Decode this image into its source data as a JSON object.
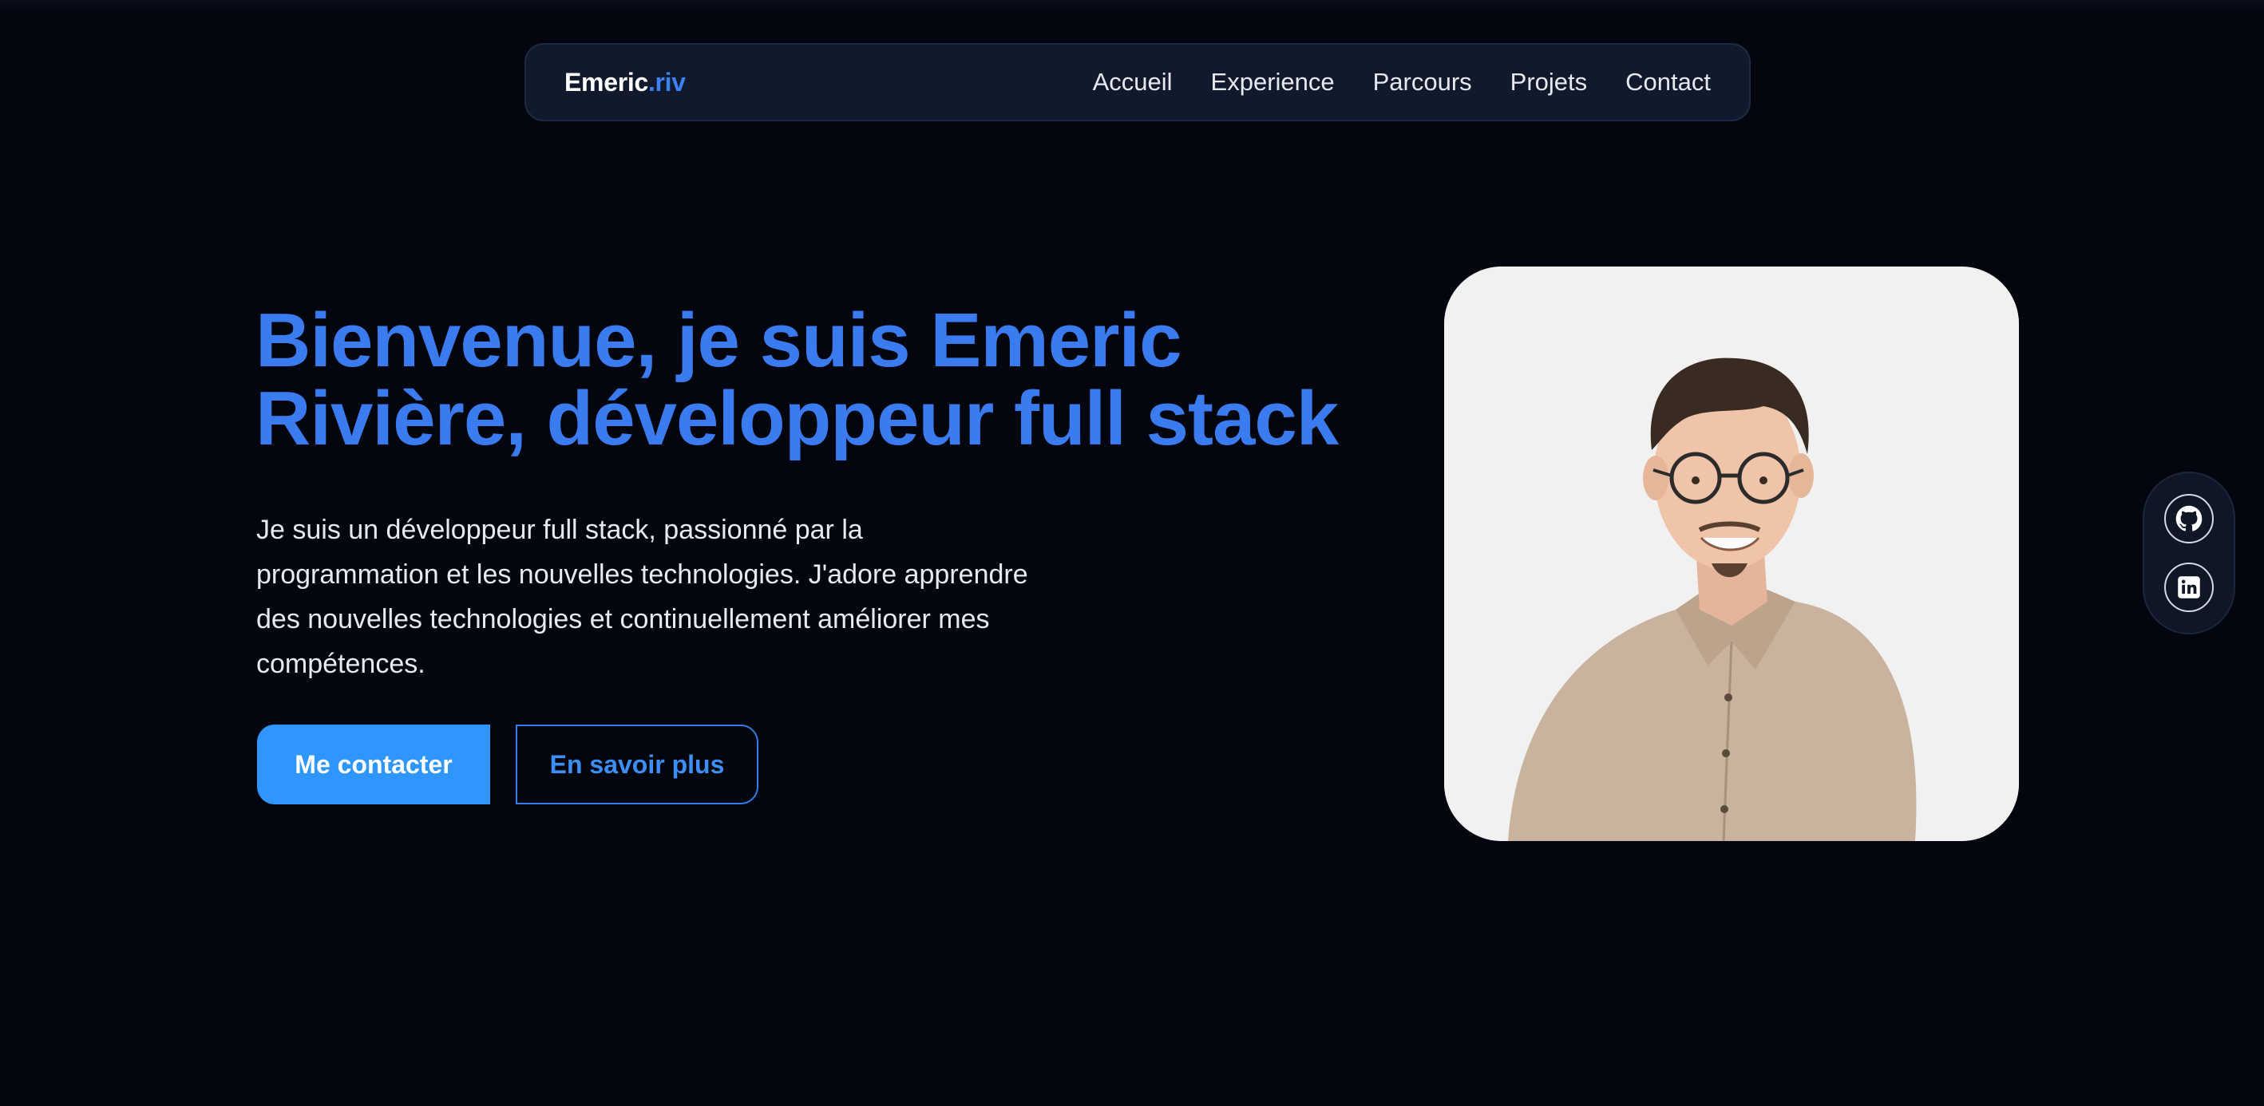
{
  "nav": {
    "logo_main": "Emeric",
    "logo_accent": ".riv",
    "links": [
      "Accueil",
      "Experience",
      "Parcours",
      "Projets",
      "Contact"
    ]
  },
  "hero": {
    "title_line1": "Bienvenue, je suis Emeric",
    "title_line2": "Rivière, développeur full stack",
    "description_lines": [
      "Je suis un développeur full stack, passionné par la",
      "programmation et les nouvelles technologies. J'adore apprendre",
      "des nouvelles technologies et continuellement améliorer mes",
      "compétences."
    ],
    "primary_button": "Me contacter",
    "secondary_button": "En savoir plus"
  },
  "social": {
    "icons": [
      "github-icon",
      "linkedin-icon"
    ]
  },
  "colors": {
    "background": "#03050f",
    "accent": "#3b7bf0",
    "button_primary": "#2f96ff",
    "navbar": "#111a2c"
  }
}
